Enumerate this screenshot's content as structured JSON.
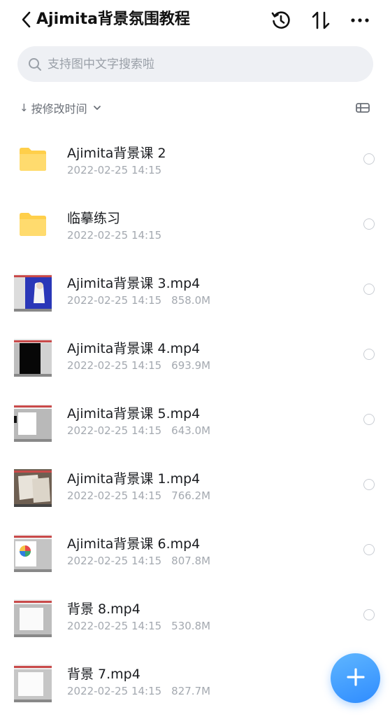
{
  "header": {
    "title": "Ajimita背景氛围教程",
    "back_icon": "chevron-left-icon",
    "history_icon": "history-clock-icon",
    "sort_icon": "sort-arrows-icon",
    "more_icon": "more-dots-icon"
  },
  "search": {
    "placeholder": "支持图中文字搜索啦"
  },
  "sort": {
    "label": "按修改时间",
    "direction": "down"
  },
  "files": [
    {
      "name": "Ajimita背景课 2",
      "date": "2022-02-25 14:15",
      "size": "",
      "type": "folder"
    },
    {
      "name": "临摹练习",
      "date": "2022-02-25 14:15",
      "size": "",
      "type": "folder"
    },
    {
      "name": "Ajimita背景课 3.mp4",
      "date": "2022-02-25 14:15",
      "size": "858.0M",
      "type": "video"
    },
    {
      "name": "Ajimita背景课 4.mp4",
      "date": "2022-02-25 14:15",
      "size": "693.9M",
      "type": "video"
    },
    {
      "name": "Ajimita背景课 5.mp4",
      "date": "2022-02-25 14:15",
      "size": "643.0M",
      "type": "video"
    },
    {
      "name": "Ajimita背景课 1.mp4",
      "date": "2022-02-25 14:15",
      "size": "766.2M",
      "type": "video"
    },
    {
      "name": "Ajimita背景课 6.mp4",
      "date": "2022-02-25 14:15",
      "size": "807.8M",
      "type": "video"
    },
    {
      "name": "背景 8.mp4",
      "date": "2022-02-25 14:15",
      "size": "530.8M",
      "type": "video"
    },
    {
      "name": "背景 7.mp4",
      "date": "2022-02-25 14:15",
      "size": "827.7M",
      "type": "video"
    }
  ],
  "fab": {
    "icon": "plus-icon"
  },
  "colors": {
    "accent": "#2f8cff",
    "folder": "#ffd35c",
    "muted": "#a4a9b0"
  }
}
